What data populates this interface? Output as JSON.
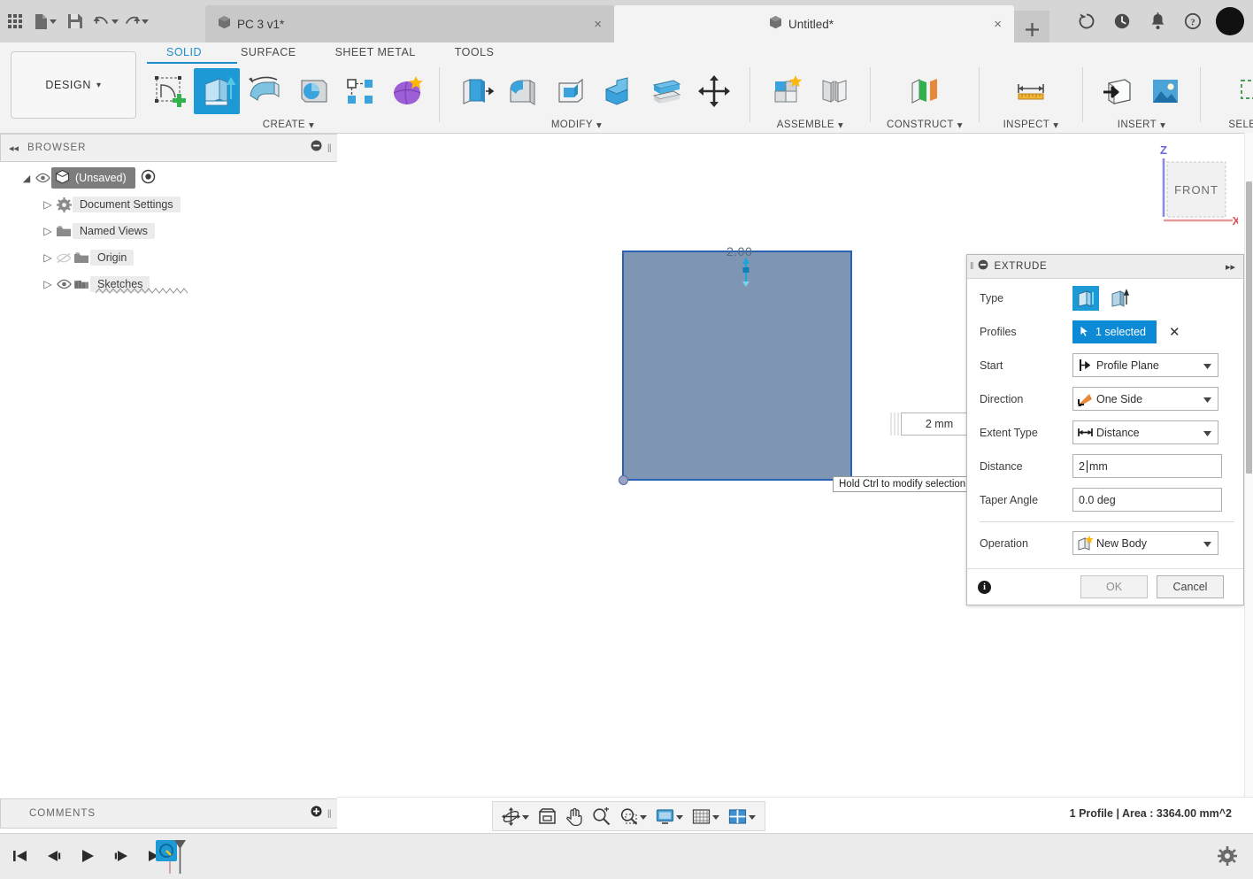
{
  "titlebar": {
    "grid_icon": "apps-grid-icon",
    "file_label": "file-menu",
    "save_label": "save-icon",
    "undo_label": "undo-icon",
    "redo_label": "redo-icon",
    "tabs": [
      {
        "name": "PC 3 v1*",
        "active": false,
        "close": "×"
      },
      {
        "name": "Untitled*",
        "active": true,
        "close": "×"
      }
    ],
    "new_tab": "+",
    "right_icons": [
      "refresh-icon",
      "recent-icon",
      "notifications-icon",
      "help-icon"
    ],
    "avatar": "user-avatar"
  },
  "ribbon": {
    "workspace": "DESIGN",
    "workspace_caret": "▾",
    "tabs": [
      {
        "label": "SOLID",
        "active": true
      },
      {
        "label": "SURFACE",
        "active": false
      },
      {
        "label": "SHEET METAL",
        "active": false
      },
      {
        "label": "TOOLS",
        "active": false
      }
    ],
    "panels": [
      {
        "label": "CREATE",
        "caret": "▾",
        "tools": [
          "create-sketch-icon",
          "extrude-icon",
          "revolve-icon",
          "sweep-icon",
          "pattern-icon",
          "form-icon"
        ]
      },
      {
        "label": "MODIFY",
        "caret": "▾",
        "tools": [
          "press-pull-icon",
          "fillet-icon",
          "shell-icon",
          "combine-icon",
          "split-face-icon",
          "move-copy-icon"
        ]
      },
      {
        "label": "ASSEMBLE",
        "caret": "▾",
        "tools": [
          "new-component-icon",
          "joint-icon"
        ]
      },
      {
        "label": "CONSTRUCT",
        "caret": "▾",
        "tools": [
          "offset-plane-icon"
        ]
      },
      {
        "label": "INSPECT",
        "caret": "▾",
        "tools": [
          "measure-icon"
        ]
      },
      {
        "label": "INSERT",
        "caret": "▾",
        "tools": [
          "insert-derive-icon",
          "insert-canvas-icon"
        ]
      },
      {
        "label": "SELECT",
        "caret": "▾",
        "tools": [
          "select-window-icon"
        ]
      }
    ]
  },
  "browser": {
    "title": "BROWSER",
    "collapse": "◂◂",
    "minus": "minus-circle-icon",
    "grip": "panel-grip",
    "tree": [
      {
        "label": "(Unsaved)",
        "indent": 0,
        "root": true,
        "arrow": "◢",
        "eye": true,
        "dot": true
      },
      {
        "label": "Document Settings",
        "indent": 1,
        "arrow": "▷",
        "icon": "gear-icon"
      },
      {
        "label": "Named Views",
        "indent": 1,
        "arrow": "▷",
        "icon": "folder-icon"
      },
      {
        "label": "Origin",
        "indent": 1,
        "arrow": "▷",
        "icon": "folder-icon",
        "eye": "hidden"
      },
      {
        "label": "Sketches",
        "indent": 1,
        "arrow": "▷",
        "icon": "sketch-folder-icon",
        "eye": true
      }
    ]
  },
  "canvas": {
    "dimension_label": "2.00",
    "distance_field": "2 mm",
    "tooltip": "Hold Ctrl to modify selection",
    "viewcube": {
      "face": "FRONT",
      "axis_z": "Z",
      "axis_x": "X"
    },
    "profile_fill": "#7e96b4",
    "profile_stroke": "#2a63b5"
  },
  "extrude_dialog": {
    "title": "EXTRUDE",
    "collapse_icon": "minus-circle-icon",
    "expand_icon": "▸▸",
    "rows": {
      "type": {
        "label": "Type",
        "options": [
          "extrude-solid-icon",
          "extrude-thin-icon"
        ],
        "selected_index": 0
      },
      "profiles": {
        "label": "Profiles",
        "value": "1 selected",
        "clear": "✕"
      },
      "start": {
        "label": "Start",
        "value": "Profile Plane",
        "icon": "profile-plane-icon"
      },
      "direction": {
        "label": "Direction",
        "value": "One Side",
        "icon": "one-side-icon"
      },
      "extent_type": {
        "label": "Extent Type",
        "value": "Distance",
        "icon": "distance-icon"
      },
      "distance": {
        "label": "Distance",
        "value": "2",
        "unit": "mm"
      },
      "taper_angle": {
        "label": "Taper Angle",
        "value": "0.0 deg"
      },
      "operation": {
        "label": "Operation",
        "value": "New Body",
        "icon": "new-body-icon"
      }
    },
    "footer": {
      "info": "i",
      "ok": "OK",
      "cancel": "Cancel"
    },
    "accent": "#0d8ad6"
  },
  "comments": {
    "title": "COMMENTS",
    "add": "add-comment-icon",
    "grip": "panel-grip"
  },
  "status": {
    "text": "1 Profile | Area : 3364.00 mm^2",
    "nav_tools": [
      "orbit-icon",
      "fit-icon",
      "pan-icon",
      "zoom-icon",
      "zoom-window-icon",
      "display-settings-icon",
      "grid-snap-icon",
      "viewports-icon"
    ]
  },
  "timeline": {
    "controls": [
      "go-to-beginning-icon",
      "step-back-icon",
      "play-icon",
      "step-forward-icon",
      "go-to-end-icon"
    ],
    "features": [
      "sketch-feature-icon"
    ],
    "settings": "timeline-settings-icon"
  }
}
